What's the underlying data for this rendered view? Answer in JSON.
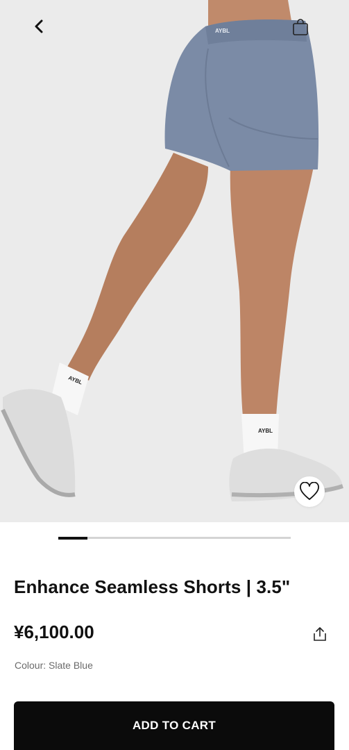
{
  "nav": {
    "back_icon": "chevron-left-icon",
    "bag_icon": "shopping-bag-icon"
  },
  "gallery": {
    "image_description": "Slate blue seamless shorts worn with white socks and silver sneakers",
    "sock_brand": "AYBL",
    "waistband_logo": "AYBL",
    "active_index": 1,
    "wishlist_icon": "heart-outline-icon"
  },
  "product": {
    "title": "Enhance Seamless Shorts | 3.5\"",
    "price": "¥6,100.00",
    "share_icon": "share-icon",
    "colour_label": "Colour: ",
    "colour_value": "Slate Blue"
  },
  "actions": {
    "add_to_cart_label": "ADD TO CART"
  },
  "colors": {
    "accent": "#0b0b0b",
    "shorts": "#7b8ba6",
    "background": "#ebebeb"
  }
}
